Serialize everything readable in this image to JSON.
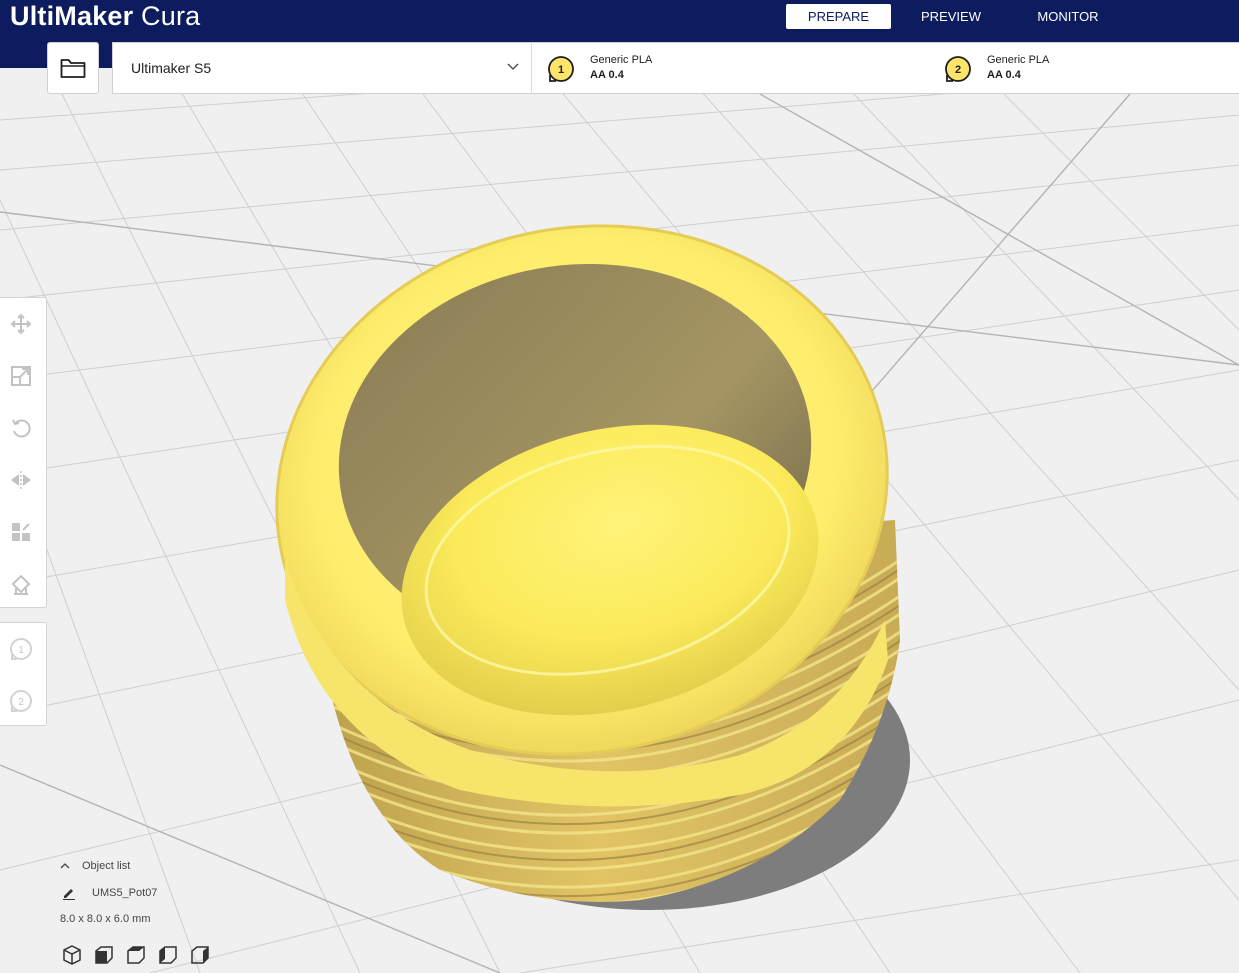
{
  "app": {
    "title_bold": "UltiMaker",
    "title_light": " Cura"
  },
  "stages": [
    {
      "label": "PREPARE",
      "active": true
    },
    {
      "label": "PREVIEW",
      "active": false
    },
    {
      "label": "MONITOR",
      "active": false
    }
  ],
  "machine": {
    "name": "Ultimaker S5"
  },
  "extruders": [
    {
      "number": "1",
      "material": "Generic PLA",
      "nozzle": "AA 0.4"
    },
    {
      "number": "2",
      "material": "Generic PLA",
      "nozzle": "AA 0.4"
    }
  ],
  "tools": [
    "move-icon",
    "scale-icon",
    "rotate-icon",
    "mirror-icon",
    "per-model-settings-icon",
    "support-blocker-icon"
  ],
  "extruder_tools": [
    {
      "number": "1"
    },
    {
      "number": "2"
    }
  ],
  "object_list": {
    "header": "Object list",
    "object_name": "UMS5_Pot07",
    "dimensions": "8.0 x 8.0 x 6.0 mm"
  },
  "view_buttons": [
    "3d-view-icon",
    "front-view-icon",
    "top-view-icon",
    "left-view-icon",
    "right-view-icon"
  ],
  "colors": {
    "header": "#0c1c5e",
    "model_yellow": "#ffef6a",
    "model_stripe": "#d9b85a",
    "viewport_bg": "#f0f0f0",
    "grid": "#cfcfcf"
  }
}
